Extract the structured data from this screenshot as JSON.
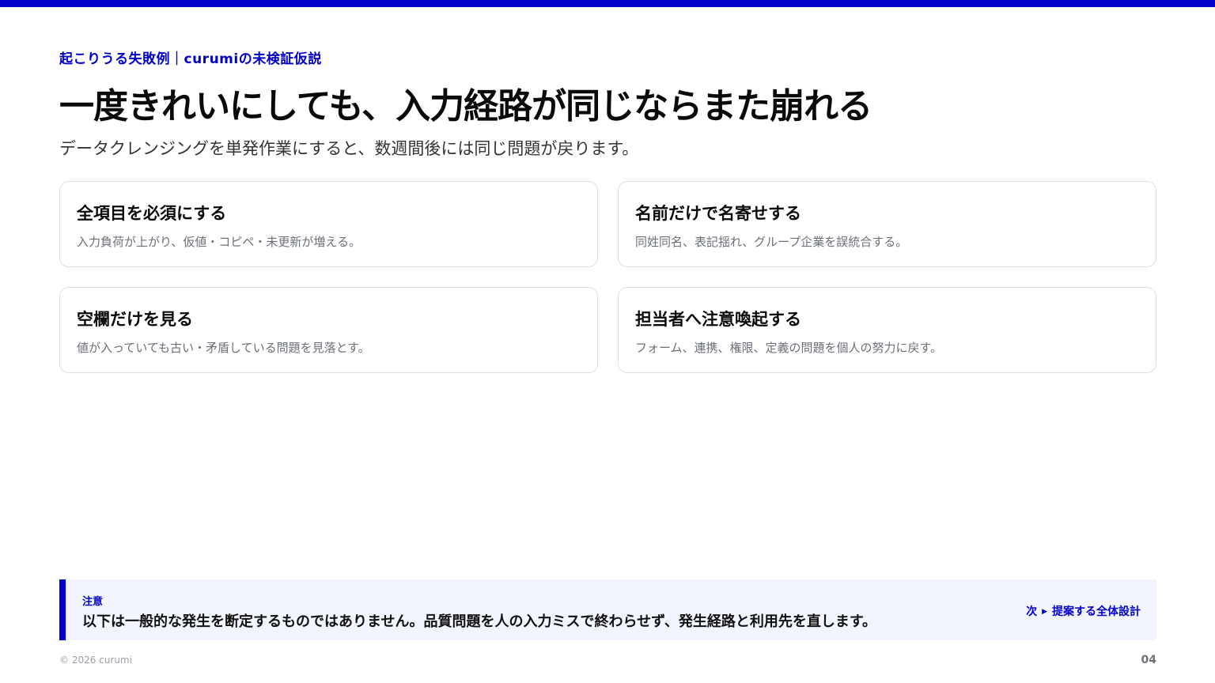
{
  "slide": {
    "eyebrow": "起こりうる失敗例｜curumiの未検証仮説",
    "title": "一度きれいにしても、入力経路が同じならまた崩れる",
    "subtitle": "データクレンジングを単発作業にすると、数週間後には同じ問題が戻ります。"
  },
  "cards": [
    {
      "title": "全項目を必須にする",
      "desc": "入力負荷が上がり、仮値・コピペ・未更新が増える。"
    },
    {
      "title": "名前だけで名寄せする",
      "desc": "同姓同名、表記揺れ、グループ企業を誤統合する。"
    },
    {
      "title": "空欄だけを見る",
      "desc": "値が入っていても古い・矛盾している問題を見落とす。"
    },
    {
      "title": "担当者へ注意喚起する",
      "desc": "フォーム、連携、権限、定義の問題を個人の努力に戻す。"
    }
  ],
  "note": {
    "label": "注意",
    "text": "以下は一般的な発生を断定するものではありません。品質問題を人の入力ミスで終わらせず、発生経路と利用先を直します。",
    "next_prefix": "次",
    "next_icon": "▶",
    "next_label": "提案する全体設計"
  },
  "footer": {
    "copyright": "© 2026 curumi",
    "page_number": "04"
  },
  "colors": {
    "accent": "#0000c8",
    "note_bg": "#f2f5fd",
    "card_border": "#dddfe6"
  }
}
